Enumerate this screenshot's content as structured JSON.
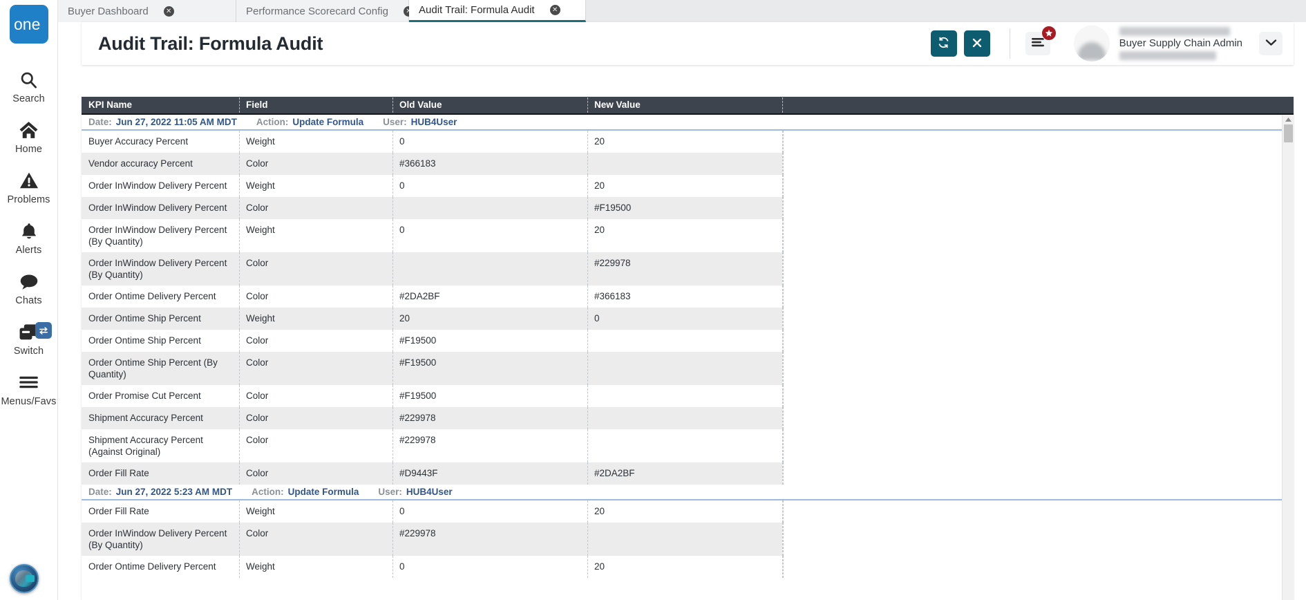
{
  "brand": {
    "logo_text": "one",
    "logo_color": "#1f80c7"
  },
  "sidebar": {
    "items": [
      {
        "label": "Search",
        "icon": "search-icon"
      },
      {
        "label": "Home",
        "icon": "home-icon"
      },
      {
        "label": "Problems",
        "icon": "warning-triangle-icon"
      },
      {
        "label": "Alerts",
        "icon": "bell-icon"
      },
      {
        "label": "Chats",
        "icon": "chat-bubble-icon"
      },
      {
        "label": "Switch",
        "icon": "windows-stack-icon",
        "badge_icon": "swap-arrows-icon"
      },
      {
        "label": "Menus/Favs",
        "icon": "hamburger-icon"
      }
    ],
    "assistant_icon": "ai-assistant-orb-icon"
  },
  "tabs": [
    {
      "label": "Buyer Dashboard",
      "active": false,
      "close_icon": "close-circle-icon"
    },
    {
      "label": "Performance Scorecard Config",
      "active": false,
      "close_icon": "close-circle-icon"
    },
    {
      "label": "Audit Trail: Formula Audit",
      "active": true,
      "close_icon": "close-circle-icon"
    }
  ],
  "header": {
    "title": "Audit Trail: Formula Audit",
    "refresh_icon": "refresh-icon",
    "close_icon": "close-x-icon",
    "menu_icon": "hamburger-icon",
    "badge_icon": "star-badge-icon",
    "avatar_icon": "user-avatar",
    "user_role": "Buyer Supply Chain Admin",
    "caret_icon": "chevron-down-icon",
    "accent_color": "#0e5c70",
    "badge_color": "#a81b22"
  },
  "table": {
    "columns": [
      "KPI Name",
      "Field",
      "Old Value",
      "New Value",
      ""
    ],
    "groups": [
      {
        "date_label": "Date:",
        "date_value": "Jun 27, 2022 11:05 AM MDT",
        "action_label": "Action:",
        "action_value": "Update Formula",
        "user_label": "User:",
        "user_value": "HUB4User",
        "rows": [
          {
            "kpi": "Buyer Accuracy Percent",
            "field": "Weight",
            "old": "0",
            "new": "20"
          },
          {
            "kpi": "Vendor accuracy Percent",
            "field": "Color",
            "old": "#366183",
            "new": ""
          },
          {
            "kpi": "Order InWindow Delivery Percent",
            "field": "Weight",
            "old": "0",
            "new": "20"
          },
          {
            "kpi": "Order InWindow Delivery Percent",
            "field": "Color",
            "old": "",
            "new": "#F19500"
          },
          {
            "kpi": "Order InWindow Delivery Percent (By Quantity)",
            "field": "Weight",
            "old": "0",
            "new": "20"
          },
          {
            "kpi": "Order InWindow Delivery Percent (By Quantity)",
            "field": "Color",
            "old": "",
            "new": "#229978"
          },
          {
            "kpi": "Order Ontime Delivery Percent",
            "field": "Color",
            "old": "#2DA2BF",
            "new": "#366183"
          },
          {
            "kpi": "Order Ontime Ship Percent",
            "field": "Weight",
            "old": "20",
            "new": "0"
          },
          {
            "kpi": "Order Ontime Ship Percent",
            "field": "Color",
            "old": "#F19500",
            "new": ""
          },
          {
            "kpi": "Order Ontime Ship Percent (By Quantity)",
            "field": "Color",
            "old": "#F19500",
            "new": ""
          },
          {
            "kpi": "Order Promise Cut Percent",
            "field": "Color",
            "old": "#F19500",
            "new": ""
          },
          {
            "kpi": "Shipment Accuracy Percent",
            "field": "Color",
            "old": "#229978",
            "new": ""
          },
          {
            "kpi": "Shipment Accuracy Percent (Against Original)",
            "field": "Color",
            "old": "#229978",
            "new": ""
          },
          {
            "kpi": "Order Fill Rate",
            "field": "Color",
            "old": "#D9443F",
            "new": "#2DA2BF"
          }
        ]
      },
      {
        "date_label": "Date:",
        "date_value": "Jun 27, 2022 5:23 AM MDT",
        "action_label": "Action:",
        "action_value": "Update Formula",
        "user_label": "User:",
        "user_value": "HUB4User",
        "rows": [
          {
            "kpi": "Order Fill Rate",
            "field": "Weight",
            "old": "0",
            "new": "20"
          },
          {
            "kpi": "Order InWindow Delivery Percent (By Quantity)",
            "field": "Color",
            "old": "#229978",
            "new": ""
          },
          {
            "kpi": "Order Ontime Delivery Percent",
            "field": "Weight",
            "old": "0",
            "new": "20"
          }
        ]
      }
    ]
  },
  "scrollbar": {
    "up_arrow_icon": "triangle-up-icon",
    "thumb": "scroll-thumb"
  }
}
